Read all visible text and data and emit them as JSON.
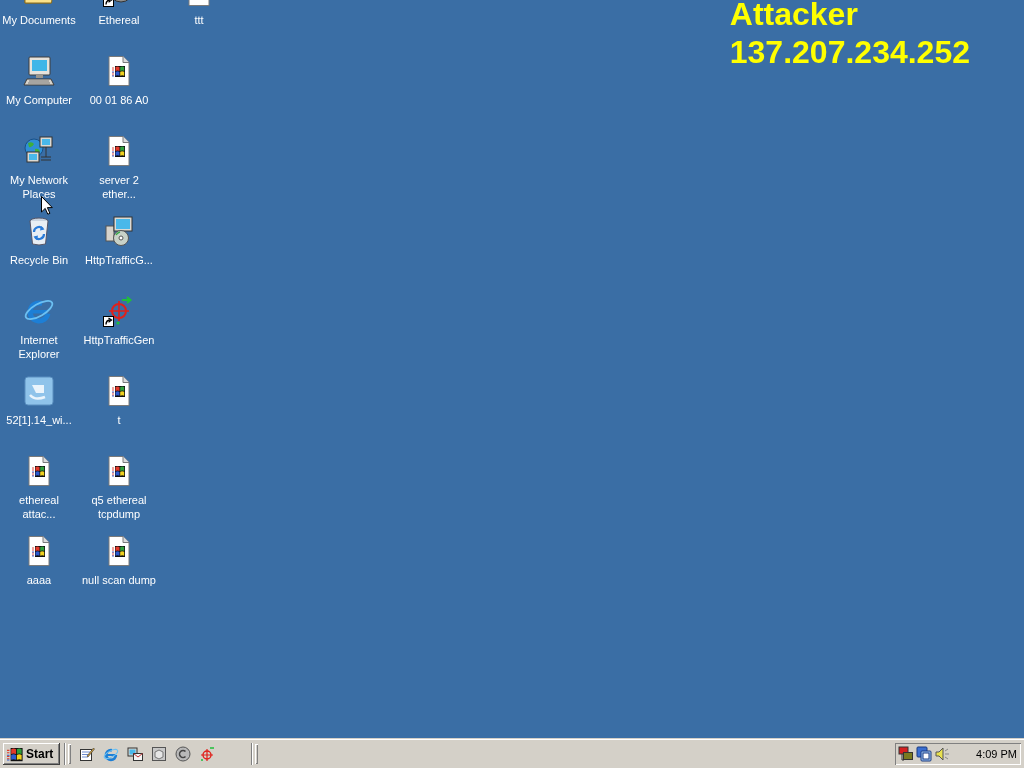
{
  "desktop": {
    "icons": [
      {
        "label_lines": [
          "My Documents"
        ],
        "kind": "folder",
        "shortcut": false
      },
      {
        "label_lines": [
          "My Computer"
        ],
        "kind": "computer",
        "shortcut": false
      },
      {
        "label_lines": [
          "My Network",
          "Places"
        ],
        "kind": "network",
        "shortcut": false
      },
      {
        "label_lines": [
          "Recycle Bin"
        ],
        "kind": "recycle",
        "shortcut": false
      },
      {
        "label_lines": [
          "Internet",
          "Explorer"
        ],
        "kind": "browser",
        "shortcut": false
      },
      {
        "label_lines": [
          "52[1].14_wi..."
        ],
        "kind": "image",
        "shortcut": false
      },
      {
        "label_lines": [
          "ethereal",
          "attac..."
        ],
        "kind": "document",
        "shortcut": false
      },
      {
        "label_lines": [
          "aaaa"
        ],
        "kind": "document",
        "shortcut": false
      },
      {
        "label_lines": [
          "Ethereal"
        ],
        "kind": "application",
        "shortcut": true
      },
      {
        "label_lines": [
          "00 01 86 A0"
        ],
        "kind": "document",
        "shortcut": false
      },
      {
        "label_lines": [
          "server 2",
          "ether..."
        ],
        "kind": "document",
        "shortcut": false
      },
      {
        "label_lines": [
          "HttpTrafficG..."
        ],
        "kind": "installer",
        "shortcut": false
      },
      {
        "label_lines": [
          "HttpTrafficGen"
        ],
        "kind": "crosshair",
        "shortcut": true
      },
      {
        "label_lines": [
          "t"
        ],
        "kind": "document",
        "shortcut": false
      },
      {
        "label_lines": [
          "q5 ethereal",
          "tcpdump"
        ],
        "kind": "document",
        "shortcut": false
      },
      {
        "label_lines": [
          "null scan dump"
        ],
        "kind": "document",
        "shortcut": false
      },
      {
        "label_lines": [
          "ttt"
        ],
        "kind": "blank_file",
        "shortcut": false
      }
    ]
  },
  "annotation": {
    "lines": [
      "Attacker",
      "137.207.234.252"
    ]
  },
  "taskbar": {
    "start_button": {
      "label": "Start"
    },
    "clock": "4:09 PM"
  }
}
